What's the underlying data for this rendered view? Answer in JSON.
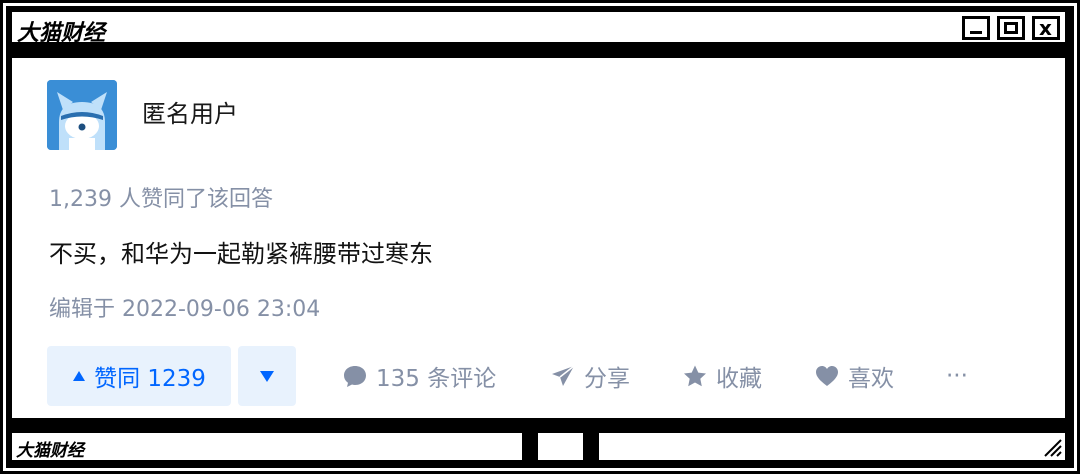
{
  "window": {
    "title": "大猫财经",
    "close_glyph": "x"
  },
  "post": {
    "author": "匿名用户",
    "likes_text": "1,239 人赞同了该回答",
    "answer_text": "不买，和华为一起勒紧裤腰带过寒东",
    "edited_text": "编辑于 2022-09-06 23:04"
  },
  "actions": {
    "upvote_label": "赞同 1239",
    "comments_label": "135 条评论",
    "share_label": "分享",
    "collect_label": "收藏",
    "like_label": "喜欢",
    "more_label": "···"
  },
  "statusbar": {
    "label": "大猫财经"
  },
  "colors": {
    "accent": "#0066ff",
    "muted": "#8590a6",
    "vote_bg": "#e8f2fd",
    "avatar_bg": "#3a8ed6"
  }
}
